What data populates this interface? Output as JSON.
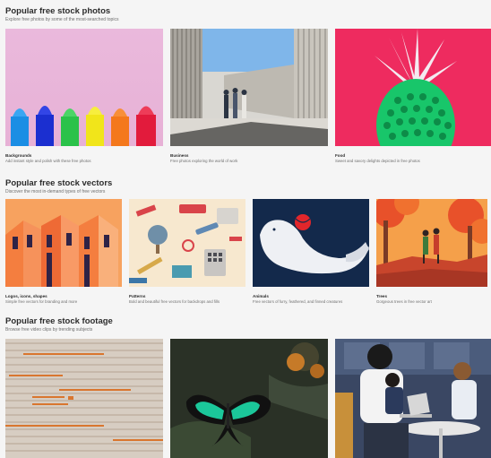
{
  "sections": [
    {
      "title": "Popular free stock photos",
      "subtitle": "Explore free photos by some of the most-searched topics",
      "cards": [
        {
          "title": "Backgrounds",
          "desc": "Add instant style and polish with these free photos"
        },
        {
          "title": "Business",
          "desc": "Free photos exploring the world of work"
        },
        {
          "title": "Food",
          "desc": "Sweet and savory delights depicted in free photos"
        }
      ]
    },
    {
      "title": "Popular free stock vectors",
      "subtitle": "Discover the most in-demand types of free vectors",
      "cards": [
        {
          "title": "Logos, icons, shapes",
          "desc": "Simple free vectors for branding and more"
        },
        {
          "title": "Patterns",
          "desc": "Bold and beautiful free vectors for backdrops and fills"
        },
        {
          "title": "Animals",
          "desc": "Free vectors of furry, feathered, and finned creatures"
        },
        {
          "title": "Trees",
          "desc": "Gorgeous trees in free vector art"
        }
      ]
    },
    {
      "title": "Popular free stock footage",
      "subtitle": "Browse free video clips by trending subjects",
      "cards": [
        {
          "title": "",
          "desc": ""
        },
        {
          "title": "",
          "desc": ""
        },
        {
          "title": "",
          "desc": ""
        }
      ]
    }
  ],
  "colors": {
    "page_bg": "#f5f5f5",
    "title": "#2c2c2c",
    "subtitle": "#6e6e6e",
    "food_bg": "#ee2b5f",
    "vector_orange": "#f78b4c",
    "animal_navy": "#13294b"
  }
}
